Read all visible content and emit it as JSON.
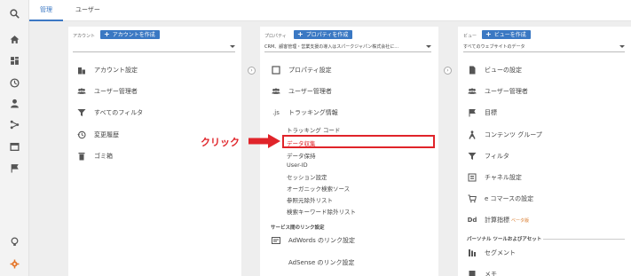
{
  "tabs": {
    "admin": "管理",
    "user": "ユーザー"
  },
  "rail": [
    "search-icon",
    "home-icon",
    "dashboard-icon",
    "clock-icon",
    "person-icon",
    "acquisition-icon",
    "behavior-icon",
    "flag-icon",
    "lightbulb-icon",
    "gear-icon"
  ],
  "account": {
    "header": "アカウント",
    "add_label": "アカウントを作成",
    "selector": "",
    "items": [
      {
        "icon": "building-icon",
        "label": "アカウント設定"
      },
      {
        "icon": "users-icon",
        "label": "ユーザー管理者"
      },
      {
        "icon": "filter-icon",
        "label": "すべてのフィルタ"
      },
      {
        "icon": "history-icon",
        "label": "変更履歴"
      },
      {
        "icon": "trash-icon",
        "label": "ゴミ箱"
      }
    ]
  },
  "property": {
    "header": "プロパティ",
    "add_label": "プロパティを作成",
    "selector": "CRM、顧客管理・営業支援の導入はスパークジャパン株式会社に...",
    "items": [
      {
        "icon": "square-icon",
        "label": "プロパティ設定"
      },
      {
        "icon": "users-icon",
        "label": "ユーザー管理者"
      },
      {
        "icon": "js-icon",
        "label": "トラッキング情報"
      }
    ],
    "sub_items": [
      "トラッキング コード",
      "データ収集",
      "データ保持",
      "User-ID",
      "セッション設定",
      "オーガニック検索ソース",
      "参照元除外リスト",
      "検索キーワード除外リスト"
    ],
    "section_title": "サービス間のリンク設定",
    "link_items": [
      {
        "icon": "adwords-icon",
        "label": "AdWords のリンク設定"
      },
      {
        "icon": "",
        "label": "AdSense のリンク設定"
      }
    ]
  },
  "view": {
    "header": "ビュー",
    "add_label": "ビューを作成",
    "selector": "すべてのウェブサイトのデータ",
    "items": [
      {
        "icon": "document-icon",
        "label": "ビューの設定"
      },
      {
        "icon": "users-icon",
        "label": "ユーザー管理者"
      },
      {
        "icon": "flag-icon",
        "label": "目標"
      },
      {
        "icon": "grouping-icon",
        "label": "コンテンツ グループ"
      },
      {
        "icon": "filter-icon",
        "label": "フィルタ"
      },
      {
        "icon": "channel-icon",
        "label": "チャネル設定"
      },
      {
        "icon": "cart-icon",
        "label": "e コマースの設定"
      },
      {
        "icon": "dd-icon",
        "label": "計算指標",
        "badge": "ベータ版"
      }
    ],
    "section_title": "パーソナル ツールおよびアセット",
    "personal_items": [
      {
        "icon": "segment-icon",
        "label": "セグメント"
      },
      {
        "icon": "note-icon",
        "label": "メモ"
      }
    ]
  },
  "annotation": {
    "label": "クリック",
    "color": "#e0242a"
  },
  "colors": {
    "accent": "#3a78c3",
    "highlight": "#e0242a"
  }
}
